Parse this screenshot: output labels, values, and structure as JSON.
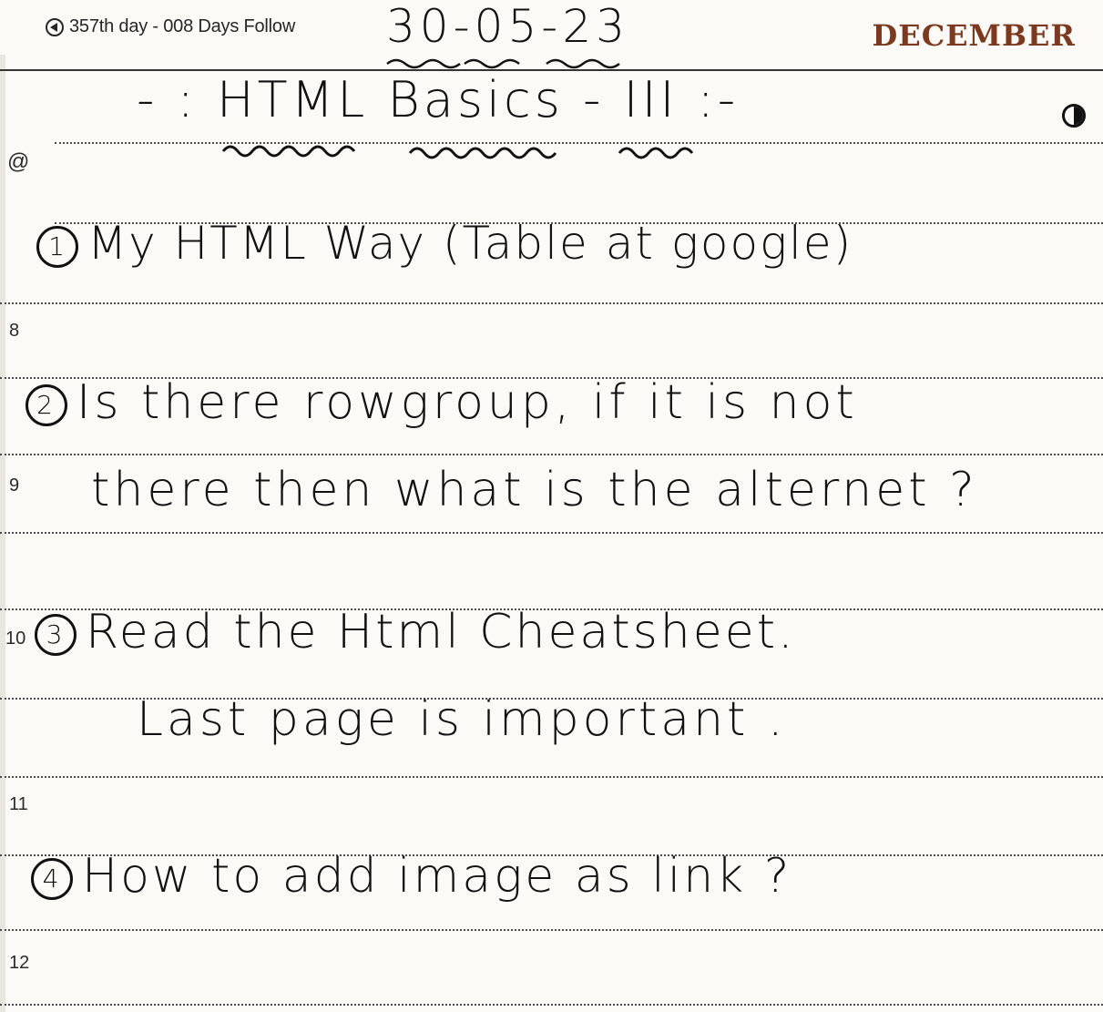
{
  "header": {
    "streak_text": "357th day - 008 Days Follow",
    "month": "DECEMBER",
    "handwritten_date": "30-05-23"
  },
  "margin": {
    "at_symbol": "@",
    "hours": [
      "8",
      "9",
      "10",
      "11",
      "12"
    ]
  },
  "notes": {
    "title": "- : HTML Basics - III :-",
    "items": [
      {
        "number": "1",
        "text": "My HTML Way (Table at google)"
      },
      {
        "number": "2",
        "text": "Is there rowgroup, if it is not",
        "continuation": "there then what is the alternet ?"
      },
      {
        "number": "3",
        "text": "Read the Html Cheatsheet.",
        "continuation": "Last page is important ."
      },
      {
        "number": "4",
        "text": "How to add image as link ?"
      }
    ]
  },
  "icons": {
    "back_circle": "circle-left-arrow-icon",
    "bullet": "half-filled-circle-icon"
  }
}
